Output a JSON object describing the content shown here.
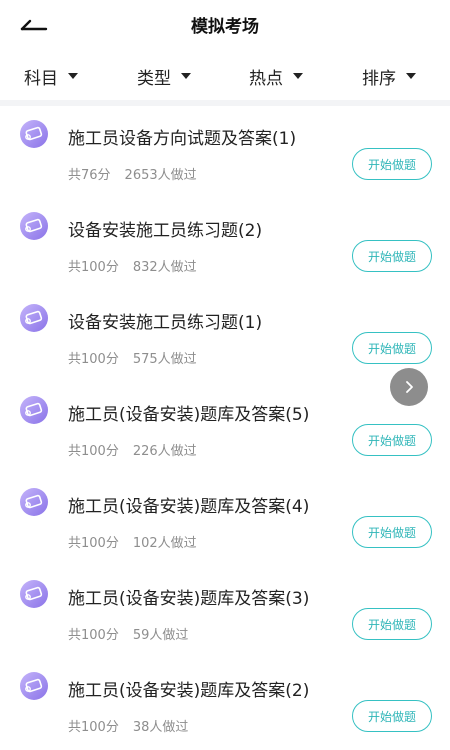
{
  "header": {
    "title": "模拟考场",
    "back_icon": "back-arrow-icon"
  },
  "filters": [
    {
      "label": "科目",
      "icon": "caret-down-icon"
    },
    {
      "label": "类型",
      "icon": "caret-down-icon"
    },
    {
      "label": "热点",
      "icon": "caret-down-icon"
    },
    {
      "label": "排序",
      "icon": "caret-down-icon"
    }
  ],
  "items": [
    {
      "title": "施工员设备方向试题及答案(1)",
      "score": "共76分",
      "participants": "2653人做过",
      "button": "开始做题",
      "icon": "scroll-icon"
    },
    {
      "title": "设备安装施工员练习题(2)",
      "score": "共100分",
      "participants": "832人做过",
      "button": "开始做题",
      "icon": "scroll-icon"
    },
    {
      "title": "设备安装施工员练习题(1)",
      "score": "共100分",
      "participants": "575人做过",
      "button": "开始做题",
      "icon": "scroll-icon"
    },
    {
      "title": "施工员(设备安装)题库及答案(5)",
      "score": "共100分",
      "participants": "226人做过",
      "button": "开始做题",
      "icon": "scroll-icon"
    },
    {
      "title": "施工员(设备安装)题库及答案(4)",
      "score": "共100分",
      "participants": "102人做过",
      "button": "开始做题",
      "icon": "scroll-icon"
    },
    {
      "title": "施工员(设备安装)题库及答案(3)",
      "score": "共100分",
      "participants": "59人做过",
      "button": "开始做题",
      "icon": "scroll-icon"
    },
    {
      "title": "施工员(设备安装)题库及答案(2)",
      "score": "共100分",
      "participants": "38人做过",
      "button": "开始做题",
      "icon": "scroll-icon"
    }
  ],
  "floating_button": {
    "icon": "chevron-right-icon"
  },
  "colors": {
    "accent": "#36c1c3",
    "icon_gradient_start": "#b9a6f7",
    "icon_gradient_end": "#8a73e8"
  }
}
